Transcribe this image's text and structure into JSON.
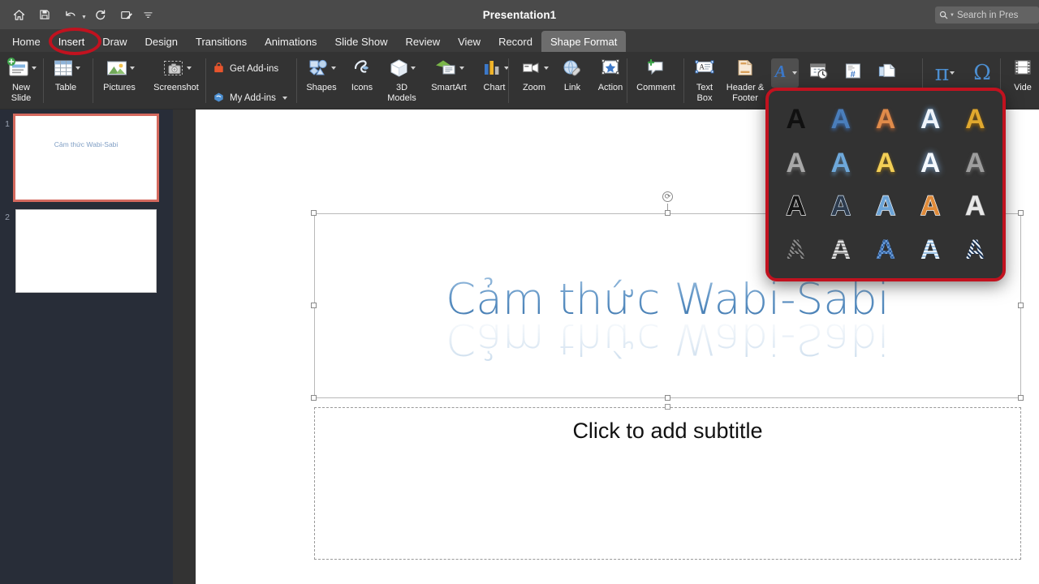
{
  "window": {
    "title": "Presentation1",
    "quick_access": [
      {
        "name": "home-icon",
        "label": "Home"
      },
      {
        "name": "save-icon",
        "label": "Save"
      },
      {
        "name": "undo-icon",
        "label": "Undo"
      },
      {
        "name": "redo-icon",
        "label": "Redo"
      },
      {
        "name": "start-inking-icon",
        "label": "Start Inking"
      },
      {
        "name": "overflow-chevron-icon",
        "label": "More"
      }
    ]
  },
  "search": {
    "placeholder": "Search in Pres",
    "icon": "search-icon"
  },
  "ribbon_tabs": [
    {
      "label": "Home",
      "active": false
    },
    {
      "label": "Insert",
      "active": false,
      "highlighted": true
    },
    {
      "label": "Draw",
      "active": false
    },
    {
      "label": "Design",
      "active": false
    },
    {
      "label": "Transitions",
      "active": false
    },
    {
      "label": "Animations",
      "active": false
    },
    {
      "label": "Slide Show",
      "active": false
    },
    {
      "label": "Review",
      "active": false
    },
    {
      "label": "View",
      "active": false
    },
    {
      "label": "Record",
      "active": false
    },
    {
      "label": "Shape Format",
      "active": true
    }
  ],
  "ribbon": {
    "group_slides": [
      {
        "label": "New\nSlide",
        "icon": "new-slide-icon",
        "has_dropdown": true
      },
      {
        "label": "Table",
        "icon": "table-icon",
        "has_dropdown": true
      }
    ],
    "group_images": [
      {
        "label": "Pictures",
        "icon": "pictures-icon",
        "has_dropdown": true
      },
      {
        "label": "Screenshot",
        "icon": "screenshot-icon",
        "has_dropdown": true
      }
    ],
    "group_addins": [
      {
        "label": "Get Add-ins",
        "icon": "get-addins-icon",
        "has_dropdown": false
      },
      {
        "label": "My Add-ins",
        "icon": "my-addins-icon",
        "has_dropdown": true
      }
    ],
    "group_illustrations": [
      {
        "label": "Shapes",
        "icon": "shapes-icon",
        "has_dropdown": true
      },
      {
        "label": "Icons",
        "icon": "icons-icon",
        "has_dropdown": false
      },
      {
        "label": "3D\nModels",
        "icon": "3d-models-icon",
        "has_dropdown": true
      },
      {
        "label": "SmartArt",
        "icon": "smartart-icon",
        "has_dropdown": true
      },
      {
        "label": "Chart",
        "icon": "chart-icon",
        "has_dropdown": true
      }
    ],
    "group_links": [
      {
        "label": "Zoom",
        "icon": "zoom-icon",
        "has_dropdown": true
      },
      {
        "label": "Link",
        "icon": "link-icon",
        "has_dropdown": false
      },
      {
        "label": "Action",
        "icon": "action-icon",
        "has_dropdown": false
      }
    ],
    "group_comments": [
      {
        "label": "Comment",
        "icon": "comment-icon",
        "has_dropdown": false
      }
    ],
    "group_text": [
      {
        "label": "Text\nBox",
        "icon": "text-box-icon",
        "has_dropdown": false
      },
      {
        "label": "Header &\nFooter",
        "icon": "header-footer-icon",
        "has_dropdown": false
      }
    ],
    "group_text_icons": [
      {
        "name": "wordart-icon",
        "label": "WordArt",
        "has_dropdown": true,
        "selected": true
      },
      {
        "name": "date-time-icon",
        "label": "Date & Time",
        "has_dropdown": false
      },
      {
        "name": "slide-number-icon",
        "label": "Slide Number",
        "has_dropdown": false
      },
      {
        "name": "object-icon",
        "label": "Object",
        "has_dropdown": false
      }
    ],
    "group_symbols": [
      {
        "name": "equation-icon",
        "label": "Equation",
        "glyph": "π",
        "has_dropdown": true
      },
      {
        "name": "symbol-icon",
        "label": "Symbol",
        "glyph": "Ω",
        "has_dropdown": false
      }
    ],
    "group_media": [
      {
        "label": "Vide",
        "icon": "video-icon",
        "has_dropdown": false
      }
    ]
  },
  "wordart_gallery": {
    "letter": "A",
    "styles": [
      {
        "index": 0,
        "name": "fill-black",
        "color": "#101010",
        "shadow": "none"
      },
      {
        "index": 1,
        "name": "fill-blue",
        "color": "#4a7ebb",
        "shadow": "soft-blue"
      },
      {
        "index": 2,
        "name": "fill-orange",
        "color": "#e08b4a",
        "shadow": "soft-orange"
      },
      {
        "index": 3,
        "name": "fill-white-blue-glow",
        "color": "#eef4fb",
        "shadow": "glow-blue"
      },
      {
        "index": 4,
        "name": "fill-gold",
        "color": "#e0a82e",
        "shadow": "soft-gold"
      },
      {
        "index": 5,
        "name": "fill-gray-reflection",
        "color": "#a8a8a8",
        "shadow": "reflection"
      },
      {
        "index": 6,
        "name": "fill-lightblue-reflect",
        "color": "#6ea8da",
        "shadow": "reflection"
      },
      {
        "index": 7,
        "name": "fill-yellow",
        "color": "#f2ce55",
        "shadow": "soft-yellow"
      },
      {
        "index": 8,
        "name": "fill-white-glow",
        "color": "#f4f8fd",
        "shadow": "glow-white"
      },
      {
        "index": 9,
        "name": "fill-silver",
        "color": "#9d9d9d",
        "shadow": "soft-gray"
      },
      {
        "index": 10,
        "name": "outline-black-white",
        "color": "#141414",
        "shadow": "outline-white"
      },
      {
        "index": 11,
        "name": "outline-dark-blue",
        "color": "#2d3b4d",
        "shadow": "outline-lightblue"
      },
      {
        "index": 12,
        "name": "outline-blue",
        "color": "#6ba3d6",
        "shadow": "outline-white"
      },
      {
        "index": 13,
        "name": "outline-orange",
        "color": "#e08b3a",
        "shadow": "outline-white"
      },
      {
        "index": 14,
        "name": "outline-white-gray",
        "color": "#e8e8e8",
        "shadow": "outline-gray"
      },
      {
        "index": 15,
        "name": "pattern-dark-gray",
        "color": "#5a5a5a",
        "shadow": "pattern-diag"
      },
      {
        "index": 16,
        "name": "pattern-silver",
        "color": "#c8c8c8",
        "shadow": "pattern-horiz"
      },
      {
        "index": 17,
        "name": "pattern-blue-check",
        "color": "#6f9ed8",
        "shadow": "pattern-check"
      },
      {
        "index": 18,
        "name": "pattern-pale-blue",
        "color": "#cfe2f3",
        "shadow": "pattern-horiz"
      },
      {
        "index": 19,
        "name": "pattern-navy-diag",
        "color": "#eaf1f8",
        "shadow": "pattern-diag-navy"
      }
    ]
  },
  "slides": [
    {
      "number": "1",
      "title": "Cảm thức Wabi-Sabi",
      "selected": true
    },
    {
      "number": "2",
      "title": "",
      "selected": false
    }
  ],
  "slide_canvas": {
    "title_text": "Cảm thức Wabi-Sabi",
    "subtitle_placeholder": "Click to add subtitle",
    "title_selected": true
  },
  "annotations": [
    {
      "name": "insert-tab-highlight",
      "shape": "ellipse",
      "color": "#c1121f"
    },
    {
      "name": "wordart-gallery-highlight",
      "shape": "rounded-rect",
      "color": "#c1121f"
    }
  ],
  "colors": {
    "titlebar": "#4a4a4a",
    "ribbon": "#333333",
    "tabbar": "#3b3b3b",
    "sidebar": "#282d38",
    "canvas": "#ffffff",
    "accent_red": "#c1121f",
    "title_blue": "#5d92c4",
    "selected_thumb_border": "#d4695e"
  }
}
